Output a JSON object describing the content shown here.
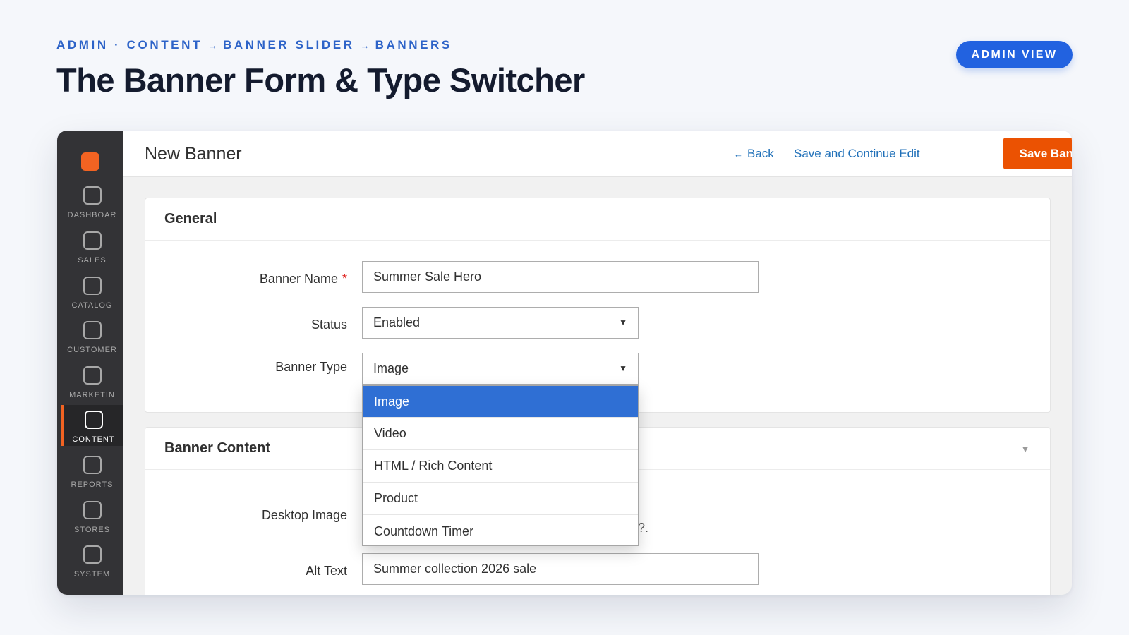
{
  "header": {
    "breadcrumb": {
      "part1": "ADMIN · CONTENT",
      "part2": "BANNER SLIDER",
      "part3": "BANNERS",
      "separator": "→"
    },
    "headline": "The Banner Form & Type Switcher",
    "admin_badge": "ADMIN VIEW"
  },
  "sidebar": {
    "items": [
      {
        "label": "DASHBOAR",
        "icon": "dashboard-icon"
      },
      {
        "label": "SALES",
        "icon": "sales-icon"
      },
      {
        "label": "CATALOG",
        "icon": "catalog-icon"
      },
      {
        "label": "CUSTOMER",
        "icon": "customer-icon"
      },
      {
        "label": "MARKETIN",
        "icon": "marketing-icon"
      },
      {
        "label": "CONTENT",
        "icon": "content-icon",
        "active": true
      },
      {
        "label": "REPORTS",
        "icon": "reports-icon"
      },
      {
        "label": "STORES",
        "icon": "stores-icon"
      },
      {
        "label": "SYSTEM",
        "icon": "system-icon"
      }
    ]
  },
  "toolbar": {
    "page_title": "New Banner",
    "back_arrow": "←",
    "back_label": "Back",
    "save_continue_label": "Save and Continue Edit",
    "save_label": "Save Banner"
  },
  "general": {
    "title": "General",
    "banner_name_label": "Banner Name",
    "required_mark": "*",
    "banner_name_value": "Summer Sale Hero",
    "status_label": "Status",
    "status_value": "Enabled",
    "banner_type_label": "Banner Type",
    "banner_type_value": "Image"
  },
  "banner_type_options": [
    "Image",
    "Video",
    "HTML / Rich Content",
    "Product",
    "Countdown Timer"
  ],
  "content": {
    "title": "Banner Content",
    "collapse_caret": "▼",
    "desktop_image_label": "Desktop Image",
    "hint_fragment": "?.",
    "alt_text_label": "Alt Text",
    "alt_text_value": "Summer collection 2026 sale"
  },
  "select_caret": "▼",
  "colors": {
    "accent_orange": "#eb5202",
    "brand_blue": "#2262e0",
    "link_blue": "#1e6fb8",
    "sidebar_bg": "#333336",
    "selected_option": "#2f6fd4"
  }
}
